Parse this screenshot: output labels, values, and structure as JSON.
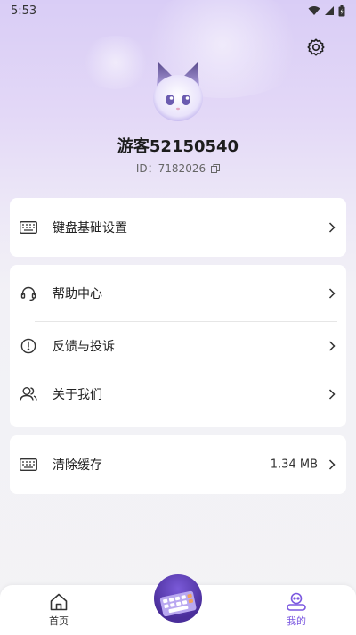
{
  "status": {
    "time": "5:53"
  },
  "profile": {
    "name": "游客52150540",
    "id_text": "ID：7182026"
  },
  "cards": {
    "keyboard_settings": {
      "label": "键盘基础设置"
    },
    "help_center": {
      "label": "帮助中心"
    },
    "feedback": {
      "label": "反馈与投诉"
    },
    "about": {
      "label": "关于我们"
    },
    "clear_cache": {
      "label": "清除缓存",
      "value": "1.34 MB"
    }
  },
  "nav": {
    "home": {
      "label": "首页"
    },
    "mine": {
      "label": "我的"
    }
  },
  "colors": {
    "accent": "#7b58e0",
    "header_gradient_top": "#d9cdf6",
    "background": "#f3f3f5"
  },
  "icons": {
    "settings": "gear-icon",
    "copy": "copy-icon",
    "keyboard": "keyboard-icon",
    "help": "headset-icon",
    "feedback": "exclamation-circle-icon",
    "about": "users-icon",
    "chevron": "chevron-right-icon",
    "home": "home-icon",
    "mine": "robot-icon"
  }
}
